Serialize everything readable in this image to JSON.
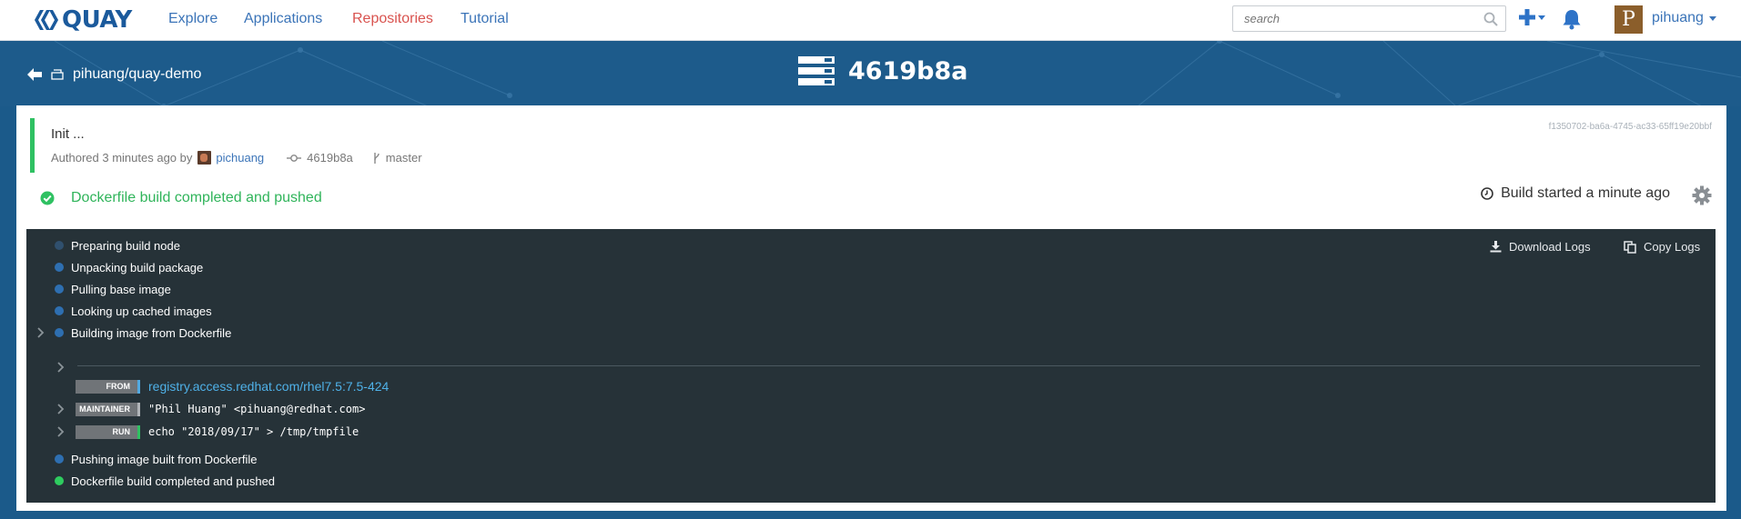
{
  "nav": {
    "brand": "QUAY",
    "links": [
      "Explore",
      "Applications",
      "Repositories",
      "Tutorial"
    ],
    "active": "Repositories",
    "search_placeholder": "search",
    "user": {
      "initial": "P",
      "name": "pihuang"
    }
  },
  "header": {
    "back_label": "pihuang/quay-demo",
    "title": "4619b8a"
  },
  "commit": {
    "message": "Init ...",
    "authored": "Authored 3 minutes ago by",
    "author": "pichuang",
    "sha": "4619b8a",
    "branch": "master",
    "build_id": "f1350702-ba6a-4745-ac33-65ff19e20bbf"
  },
  "status": {
    "text": "Dockerfile build completed and pushed",
    "started": "Build started a minute ago",
    "color": "#2fb45a"
  },
  "log": {
    "download_label": "Download Logs",
    "copy_label": "Copy Logs",
    "phases": [
      {
        "label": "Preparing build node",
        "state": "done-dim"
      },
      {
        "label": "Unpacking build package",
        "state": "done"
      },
      {
        "label": "Pulling base image",
        "state": "done"
      },
      {
        "label": "Looking up cached images",
        "state": "done"
      },
      {
        "label": "Building image from Dockerfile",
        "state": "done"
      }
    ],
    "commands": [
      {
        "keyword": "FROM",
        "arg": "registry.access.redhat.com/rhel7.5:7.5-424"
      },
      {
        "keyword": "MAINTAINER",
        "arg": "\"Phil Huang\" <pihuang@redhat.com>"
      },
      {
        "keyword": "RUN",
        "arg": "echo \"2018/09/17\" > /tmp/tmpfile"
      }
    ],
    "final_phases": [
      {
        "label": "Pushing image built from Dockerfile",
        "state": "done"
      },
      {
        "label": "Dockerfile build completed and pushed",
        "state": "complete"
      }
    ]
  },
  "colors": {
    "brand": "#1b5a9c",
    "header_band": "#1d5b8b",
    "log_bg": "#263238",
    "success": "#2fc162",
    "link": "#3b74b8"
  }
}
